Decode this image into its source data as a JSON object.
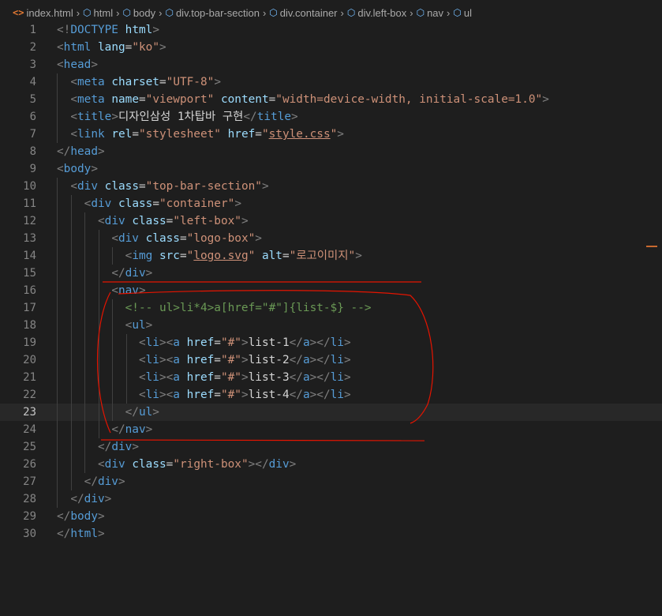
{
  "breadcrumb": {
    "items": [
      "index.html",
      "html",
      "body",
      "div.top-bar-section",
      "div.container",
      "div.left-box",
      "nav",
      "ul"
    ]
  },
  "editor": {
    "line_numbers": [
      "1",
      "2",
      "3",
      "4",
      "5",
      "6",
      "7",
      "8",
      "9",
      "10",
      "11",
      "12",
      "13",
      "14",
      "15",
      "16",
      "17",
      "18",
      "19",
      "20",
      "21",
      "22",
      "23",
      "24",
      "25",
      "26",
      "27",
      "28",
      "29",
      "30"
    ],
    "current_line": 23
  },
  "colors": {
    "background": "#1e1e1e",
    "tag": "#569cd6",
    "attribute": "#9cdcfe",
    "string": "#ce9178",
    "comment": "#6a9955",
    "annotation": "#e51400"
  },
  "icons": {
    "file": "html-file-icon",
    "element": "symbol-cube-icon",
    "separator": "chevron-right-icon"
  }
}
